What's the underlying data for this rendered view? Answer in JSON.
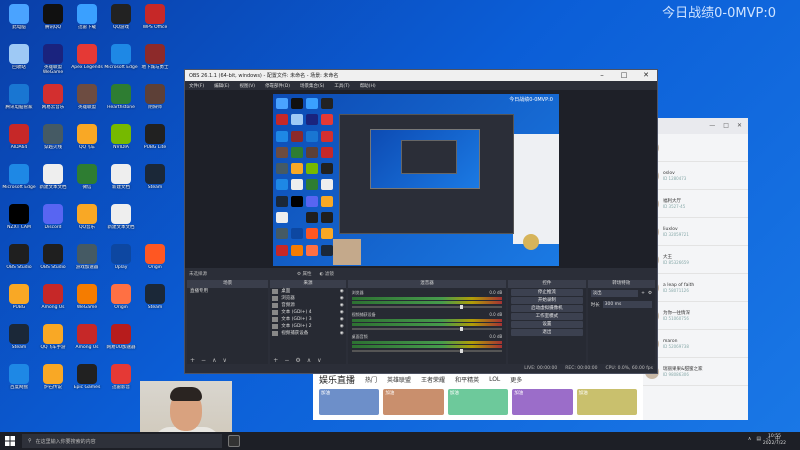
{
  "desktop_icons": [
    {
      "label": "此电脑",
      "color": "#4aa3ff"
    },
    {
      "label": "腾讯QQ",
      "color": "#111111"
    },
    {
      "label": "迅雷下载",
      "color": "#3aa0ff"
    },
    {
      "label": "QQ游戏",
      "color": "#222222"
    },
    {
      "label": "WPS Office",
      "color": "#c62828"
    },
    {
      "label": "回收站",
      "color": "#9ec9f5"
    },
    {
      "label": "英雄联盟WeGame",
      "color": "#1a237e"
    },
    {
      "label": "Apex Legends",
      "color": "#e53935"
    },
    {
      "label": "Microsoft Edge",
      "color": "#1e88e5"
    },
    {
      "label": "地下城与勇士",
      "color": "#8d2a2a"
    },
    {
      "label": "腾讯电脑管家",
      "color": "#1976d2"
    },
    {
      "label": "网易云音乐",
      "color": "#d32f2f"
    },
    {
      "label": "英雄联盟",
      "color": "#6d4c41"
    },
    {
      "label": "Hearthstone",
      "color": "#2e7d32"
    },
    {
      "label": "阴阳师",
      "color": "#5d4037"
    },
    {
      "label": "AIDA64",
      "color": "#c62828"
    },
    {
      "label": "穿越火线",
      "color": "#455a64"
    },
    {
      "label": "QQ飞车",
      "color": "#f9a825"
    },
    {
      "label": "NVIDIA",
      "color": "#76b900"
    },
    {
      "label": "PUBG Lite",
      "color": "#212121"
    },
    {
      "label": "Microsoft Edge",
      "color": "#1e88e5"
    },
    {
      "label": "新建文本文档",
      "color": "#eeeeee"
    },
    {
      "label": "微信",
      "color": "#2e7d32"
    },
    {
      "label": "新建文档",
      "color": "#eeeeee"
    },
    {
      "label": "Steam",
      "color": "#1b2838"
    },
    {
      "label": "NZXT CAM",
      "color": "#000000"
    },
    {
      "label": "Discord",
      "color": "#5865f2"
    },
    {
      "label": "QQ音乐",
      "color": "#f9a825"
    },
    {
      "label": "新建文本文档",
      "color": "#eeeeee"
    },
    {
      "label": "",
      "color": "transparent"
    },
    {
      "label": "OBS Studio",
      "color": "#1f1f1f"
    },
    {
      "label": "OBS Studio",
      "color": "#1f1f1f"
    },
    {
      "label": "游戏加速器",
      "color": "#455a64"
    },
    {
      "label": "Uplay",
      "color": "#0d47a1"
    },
    {
      "label": "Origin",
      "color": "#ff5722"
    },
    {
      "label": "PUBG",
      "color": "#f9a825"
    },
    {
      "label": "Among Us",
      "color": "#c62828"
    },
    {
      "label": "WeGame",
      "color": "#f57c00"
    },
    {
      "label": "Origin",
      "color": "#ff7043"
    },
    {
      "label": "Steam",
      "color": "#1b2838"
    },
    {
      "label": "Steam",
      "color": "#1b2838"
    },
    {
      "label": "QQ飞车手游",
      "color": "#f9a825"
    },
    {
      "label": "Among Us",
      "color": "#c62828"
    },
    {
      "label": "网易UU加速器",
      "color": "#b71c1c"
    },
    {
      "label": "",
      "color": "transparent"
    },
    {
      "label": "百度网盘",
      "color": "#1e88e5"
    },
    {
      "label": "炉石传说",
      "color": "#f9a825"
    },
    {
      "label": "Epic Games",
      "color": "#212121"
    },
    {
      "label": "迅雷影音",
      "color": "#e53935"
    },
    {
      "label": "",
      "color": "transparent"
    }
  ],
  "score_text": "今日战绩0-0MVP:0",
  "obs": {
    "title": "OBS 26.1.1 (64-bit, windows) - 配置文件: 未命名 - 场景: 未命名",
    "menu": [
      "文件(F)",
      "编辑(E)",
      "视图(V)",
      "停靠部件(D)",
      "场景集合(S)",
      "工具(T)",
      "帮助(H)"
    ],
    "preview_score": "今日战绩0-0MVP:0",
    "strip_label": "未选择源",
    "strip_controls": [
      "属性",
      "滤镜"
    ],
    "docks": {
      "scenes": {
        "title": "场景",
        "items": [
          "直播专用"
        ]
      },
      "sources": {
        "title": "来源",
        "items": [
          "桌面",
          "浏览器",
          "音频源",
          "文本 (GDI+) 4",
          "文本 (GDI+) 3",
          "文本 (GDI+) 2",
          "视频捕获设备"
        ]
      },
      "mixer": {
        "title": "混音器",
        "channels": [
          {
            "name": "浏览器",
            "db": "0.0 dB"
          },
          {
            "name": "视频捕获设备",
            "db": "0.0 dB"
          },
          {
            "name": "桌面音频",
            "db": "0.0 dB"
          }
        ]
      },
      "controls": {
        "title": "控件",
        "buttons": [
          "停止推流",
          "开始录制",
          "启动虚拟摄像机",
          "工作室模式",
          "设置",
          "退出"
        ]
      },
      "transitions": {
        "title": "转场特效",
        "type": "淡出",
        "duration_label": "时长",
        "duration": "300 ms"
      }
    },
    "status": {
      "live": "LIVE: 00:00:00",
      "rec": "REC: 00:00:00",
      "cpu": "CPU: 0.0%, 60.00 fps"
    }
  },
  "bgapp_rows": [
    {
      "t1": "",
      "t2": ""
    },
    {
      "t1": "oslov",
      "t2": "ID 1280473"
    },
    {
      "t1": "福利大厅",
      "t2": "ID 3527-45"
    },
    {
      "t1": "liuxlov",
      "t2": "ID 32059721"
    },
    {
      "t1": "大王",
      "t2": "ID 85326659"
    },
    {
      "t1": "a leap of faith",
      "t2": "ID 58071126"
    },
    {
      "t1": "为你一往情深",
      "t2": "ID 51060756"
    },
    {
      "t1": "maron",
      "t2": "ID 52069738"
    },
    {
      "t1": "瑞丽果果&甜蜜之家",
      "t2": "ID 98086306"
    }
  ],
  "bgpage": {
    "brand": "娱乐直播",
    "nav": [
      "热门",
      "英雄联盟",
      "王者荣耀",
      "和平精英",
      "LOL",
      "更多"
    ],
    "thumbs": [
      "加油",
      "加油",
      "加油",
      "加油",
      "加油"
    ]
  },
  "taskbar": {
    "search_placeholder": "在这里输入你要搜索的内容",
    "time": "10:55",
    "date": "2022/7/22"
  }
}
